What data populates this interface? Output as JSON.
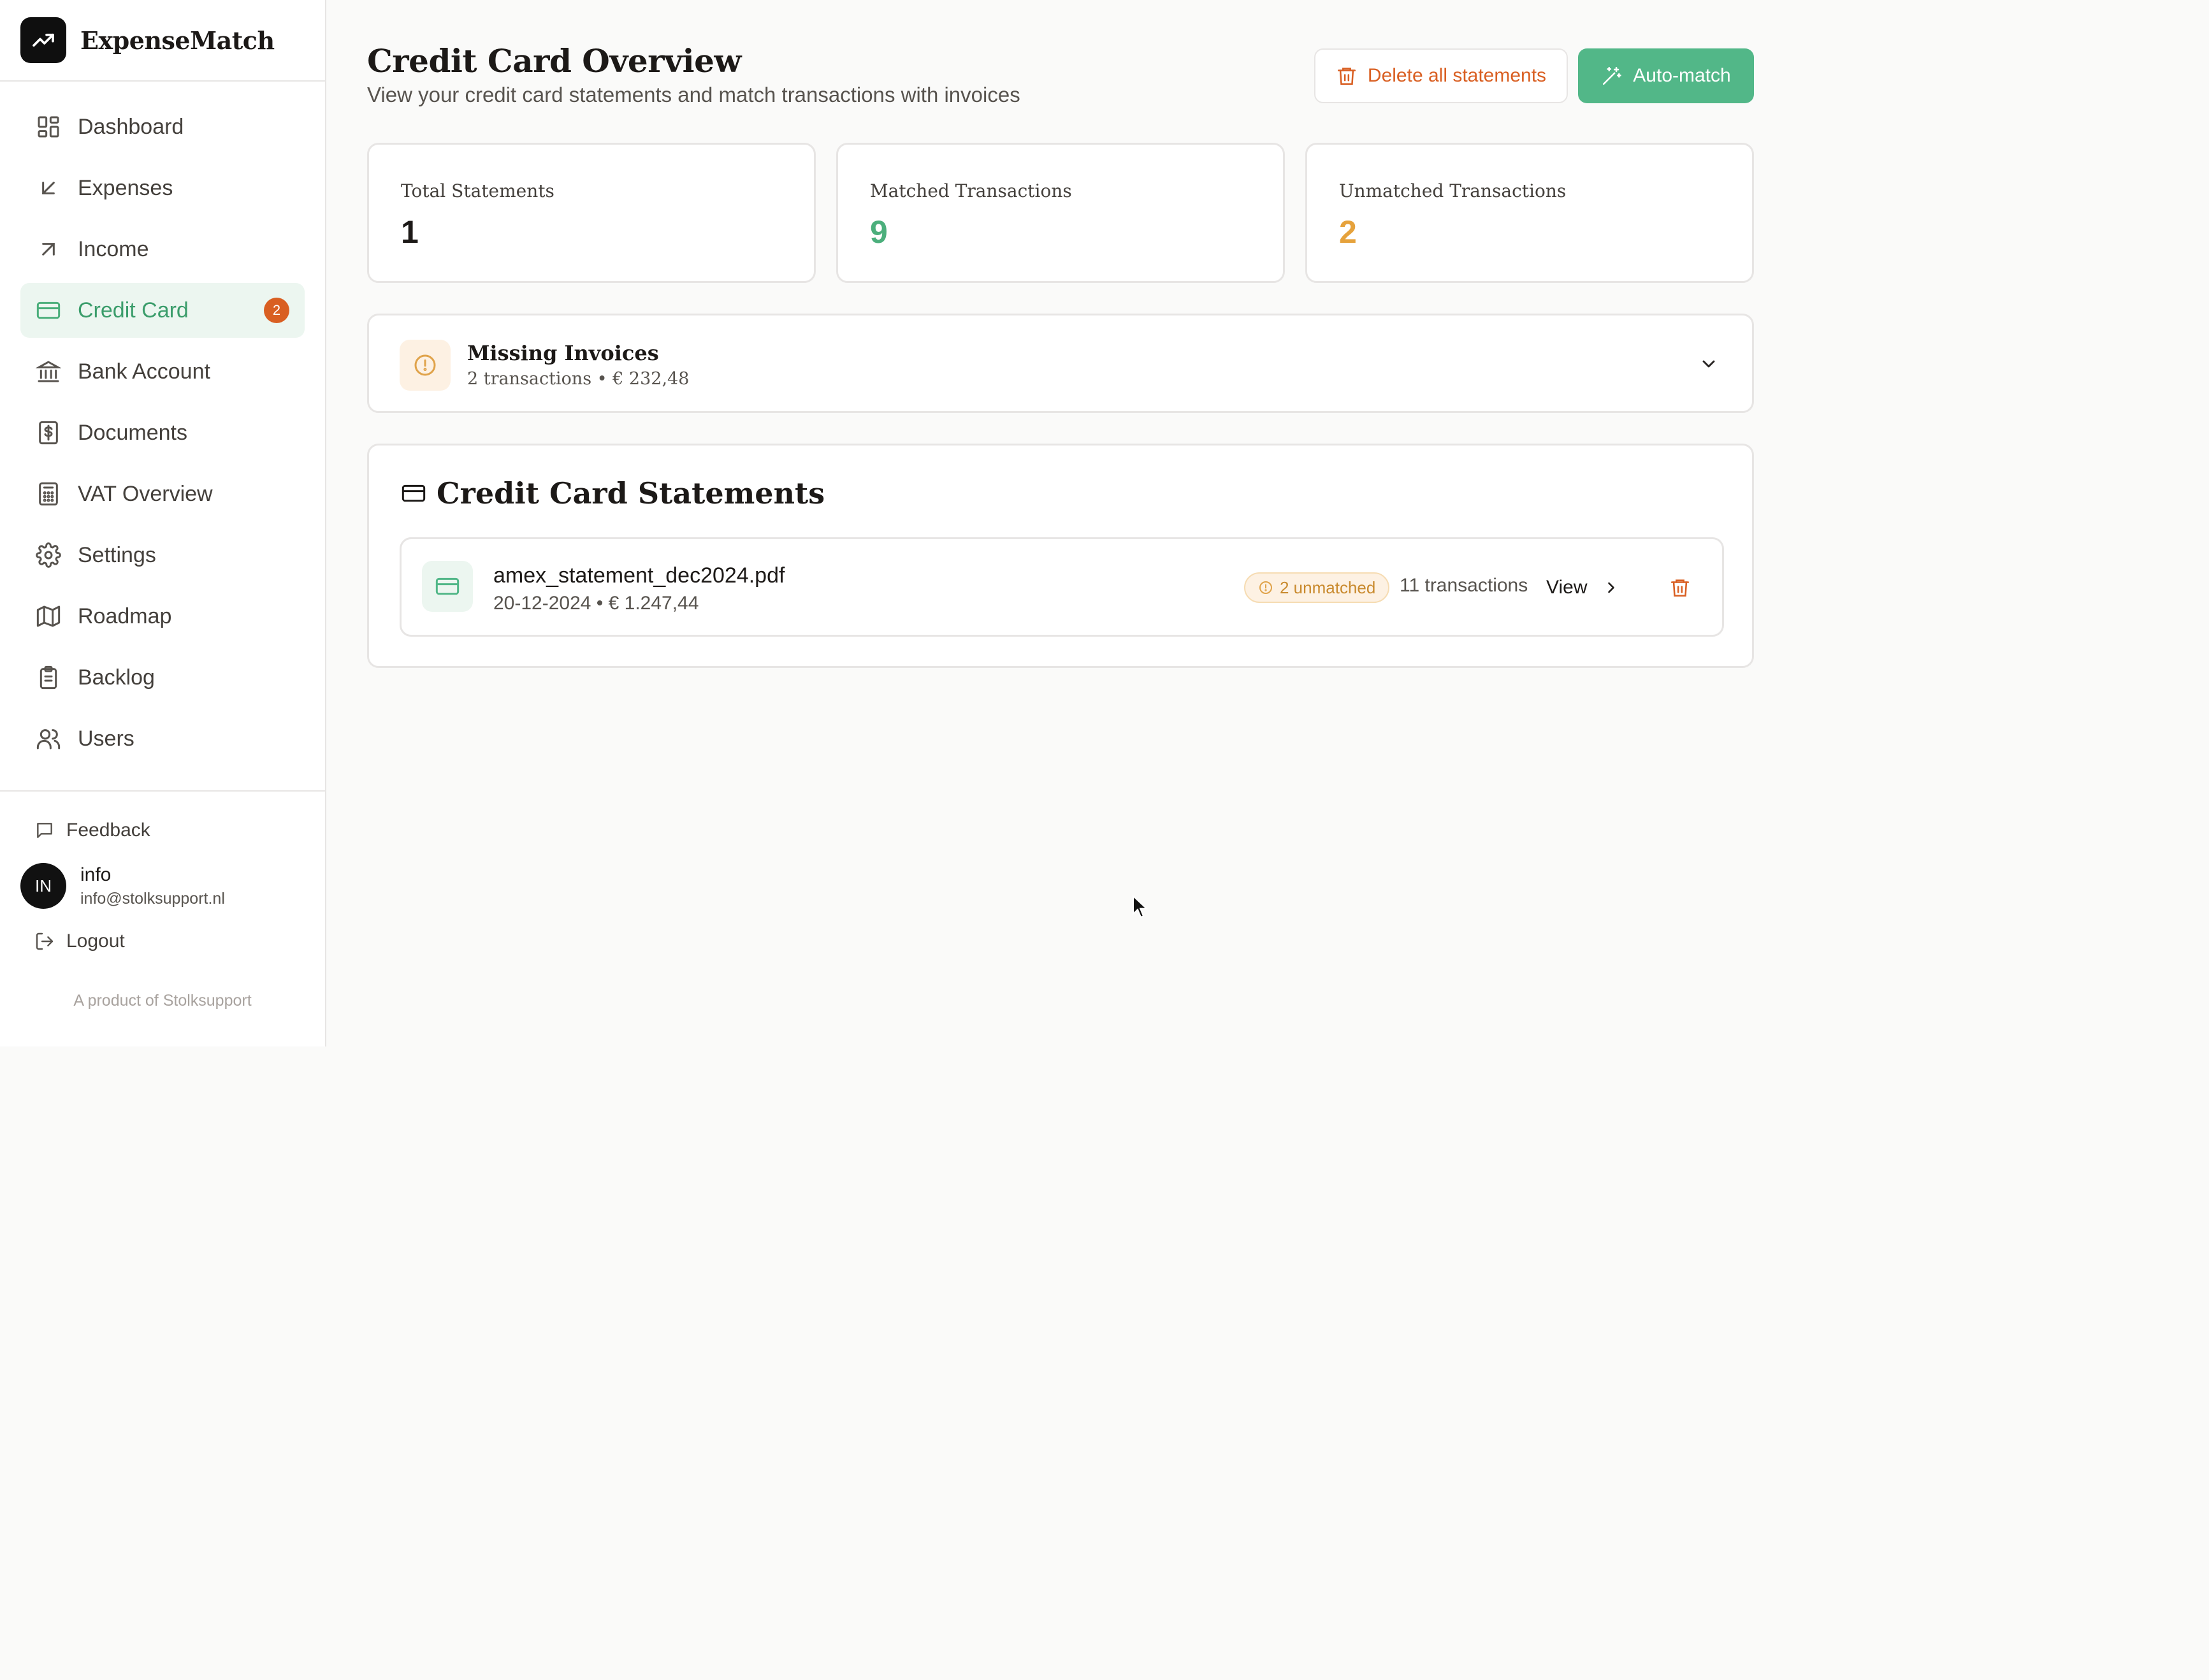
{
  "brand": {
    "name": "ExpenseMatch",
    "icon": "trending-up-icon"
  },
  "sidebar": {
    "items": [
      {
        "label": "Dashboard",
        "icon": "dashboard-icon",
        "active": false
      },
      {
        "label": "Expenses",
        "icon": "arrow-down-left-icon",
        "active": false
      },
      {
        "label": "Income",
        "icon": "arrow-up-right-icon",
        "active": false
      },
      {
        "label": "Credit Card",
        "icon": "credit-card-icon",
        "active": true,
        "badge": "2"
      },
      {
        "label": "Bank Account",
        "icon": "bank-icon",
        "active": false
      },
      {
        "label": "Documents",
        "icon": "document-dollar-icon",
        "active": false
      },
      {
        "label": "VAT Overview",
        "icon": "calculator-icon",
        "active": false
      },
      {
        "label": "Settings",
        "icon": "gear-icon",
        "active": false
      },
      {
        "label": "Roadmap",
        "icon": "map-icon",
        "active": false
      },
      {
        "label": "Backlog",
        "icon": "clipboard-icon",
        "active": false
      },
      {
        "label": "Users",
        "icon": "users-icon",
        "active": false
      }
    ],
    "feedback_label": "Feedback",
    "user": {
      "initials": "IN",
      "name": "info",
      "email": "info@stolksupport.nl"
    },
    "logout_label": "Logout",
    "product_note": "A product of Stolksupport"
  },
  "header": {
    "title": "Credit Card Overview",
    "subtitle": "View your credit card statements and match transactions with invoices",
    "delete_label": "Delete all statements",
    "automatch_label": "Auto-match"
  },
  "stats": [
    {
      "title": "Total Statements",
      "value": "1",
      "color": "#1c1917"
    },
    {
      "title": "Matched Transactions",
      "value": "9",
      "color": "#4caf7c"
    },
    {
      "title": "Unmatched Transactions",
      "value": "2",
      "color": "#e6a23c"
    }
  ],
  "missing": {
    "title": "Missing Invoices",
    "summary": "2 transactions • € 232,48"
  },
  "statements": {
    "heading": "Credit Card Statements",
    "rows": [
      {
        "filename": "amex_statement_dec2024.pdf",
        "meta": "20-12-2024 • € 1.247,44",
        "unmatched": "2 unmatched",
        "transactions": "11 transactions",
        "view_label": "View"
      }
    ]
  },
  "colors": {
    "accent": "#52b788",
    "danger": "#d95f22",
    "warning": "#e6a23c"
  }
}
